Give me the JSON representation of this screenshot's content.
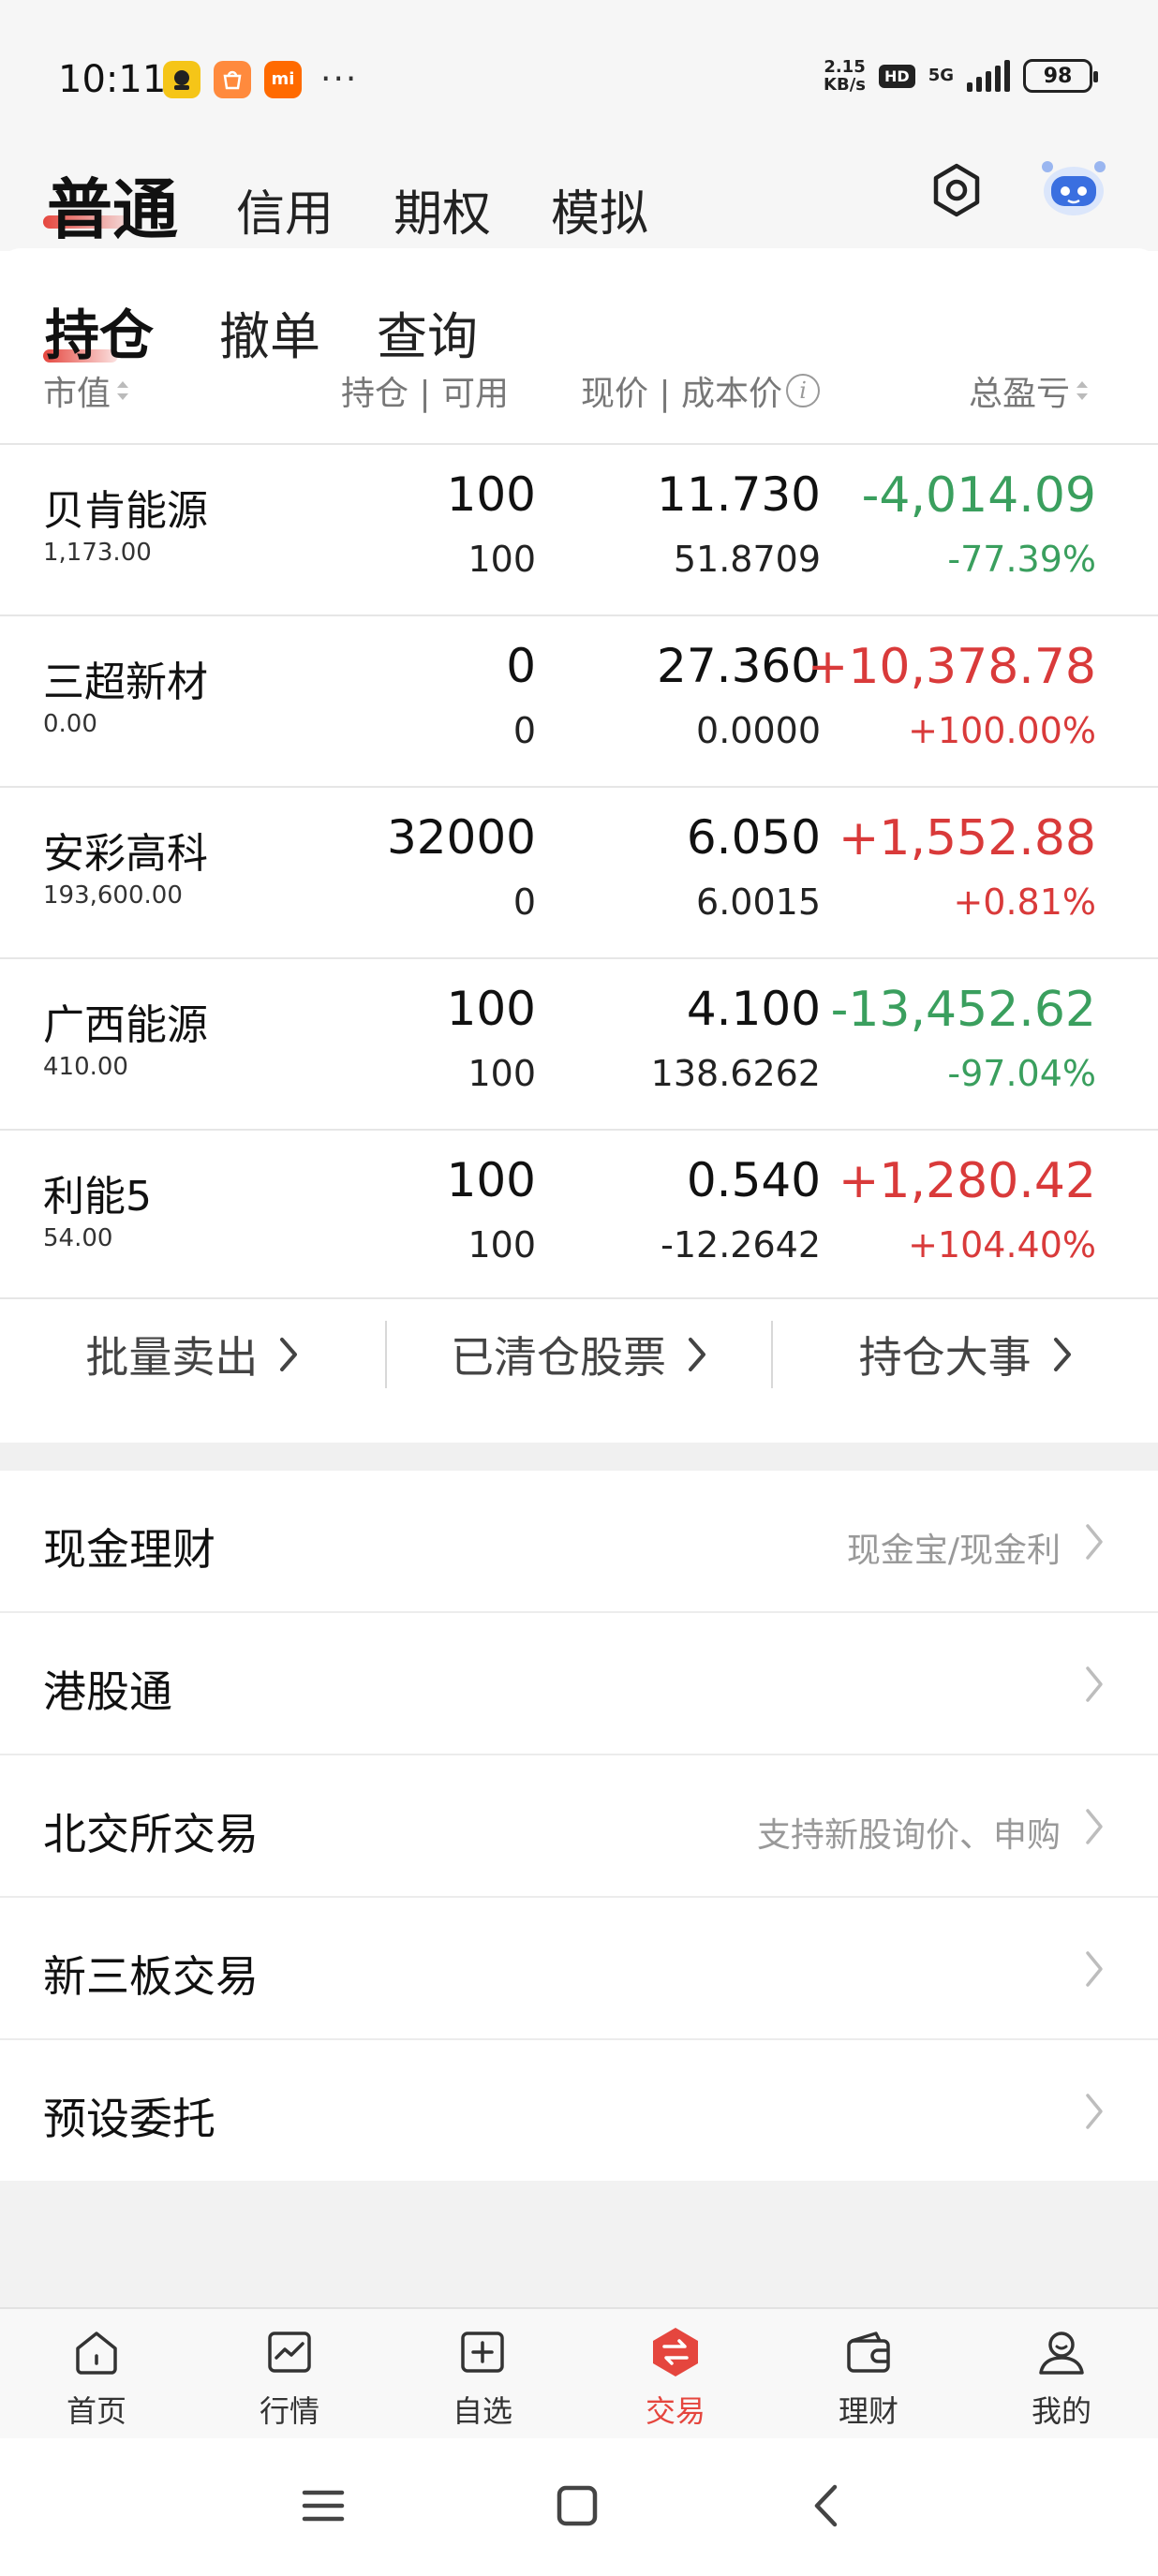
{
  "status_bar": {
    "time": "10:11",
    "app_icons": [
      "app-icon-1",
      "app-icon-2",
      "app-icon-3"
    ],
    "app3_label": "mi",
    "more": "···",
    "net_speed_top": "2.15",
    "net_speed_bottom": "KB/s",
    "hd": "HD",
    "network": "5G",
    "battery": "98"
  },
  "top_nav": {
    "tabs": [
      "普通",
      "信用",
      "期权",
      "模拟"
    ],
    "active_index": 0
  },
  "sub_tabs": {
    "tabs": [
      "持仓",
      "撤单",
      "查询"
    ],
    "active_index": 0
  },
  "columns": {
    "market_value": "市值",
    "position_available": "持仓 | 可用",
    "price_cost": "现价 | 成本价",
    "info": "i",
    "total_pl": "总盈亏"
  },
  "holdings": [
    {
      "name": "贝肯能源",
      "market_value": "1,173.00",
      "position": "100",
      "available": "100",
      "price": "11.730",
      "cost": "51.8709",
      "pl": "-4,014.09",
      "pl_pct": "-77.39%",
      "direction": "down"
    },
    {
      "name": "三超新材",
      "market_value": "0.00",
      "position": "0",
      "available": "0",
      "price": "27.360",
      "cost": "0.0000",
      "pl": "+10,378.78",
      "pl_pct": "+100.00%",
      "direction": "up"
    },
    {
      "name": "安彩高科",
      "market_value": "193,600.00",
      "position": "32000",
      "available": "0",
      "price": "6.050",
      "cost": "6.0015",
      "pl": "+1,552.88",
      "pl_pct": "+0.81%",
      "direction": "up"
    },
    {
      "name": "广西能源",
      "market_value": "410.00",
      "position": "100",
      "available": "100",
      "price": "4.100",
      "cost": "138.6262",
      "pl": "-13,452.62",
      "pl_pct": "-97.04%",
      "direction": "down"
    },
    {
      "name": "利能5",
      "market_value": "54.00",
      "position": "100",
      "available": "100",
      "price": "0.540",
      "cost": "-12.2642",
      "pl": "+1,280.42",
      "pl_pct": "+104.40%",
      "direction": "up"
    }
  ],
  "actions": [
    "批量卖出",
    "已清仓股票",
    "持仓大事"
  ],
  "menu": [
    {
      "label": "现金理财",
      "desc": "现金宝/现金利"
    },
    {
      "label": "港股通",
      "desc": ""
    },
    {
      "label": "北交所交易",
      "desc": "支持新股询价、申购"
    },
    {
      "label": "新三板交易",
      "desc": ""
    },
    {
      "label": "预设委托",
      "desc": ""
    }
  ],
  "tabbar": {
    "items": [
      "首页",
      "行情",
      "自选",
      "交易",
      "理财",
      "我的"
    ],
    "active_index": 3
  },
  "colors": {
    "accent": "#e5463e",
    "up": "#d93a3a",
    "down": "#3a9f5e"
  }
}
